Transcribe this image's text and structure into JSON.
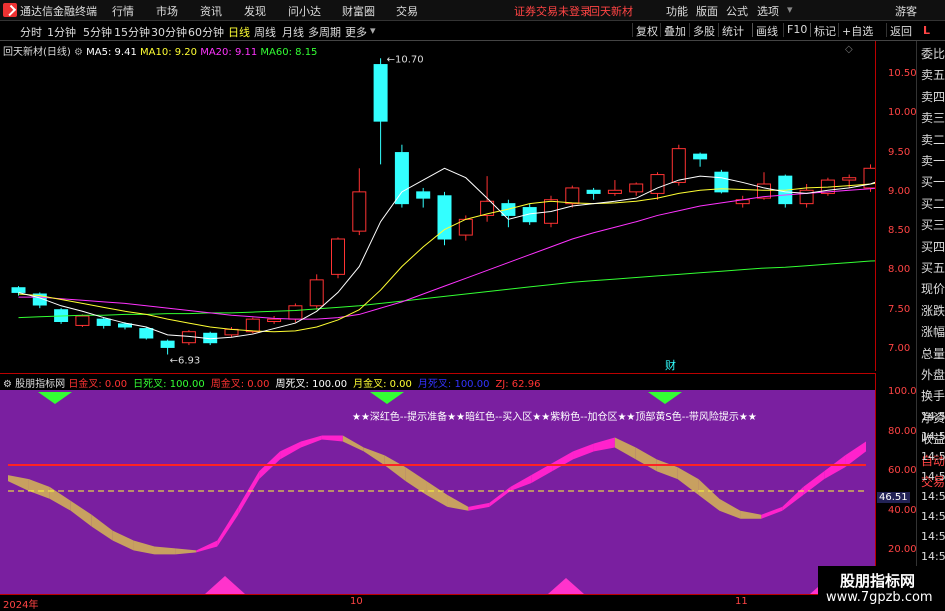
{
  "app": {
    "title": "通达信金融终端",
    "menu": [
      "行情",
      "市场",
      "资讯",
      "发现",
      "问小达",
      "财富圈",
      "交易"
    ],
    "notice": "证券交易未登录",
    "stock_name": "回天新材",
    "right_menu": [
      "功能",
      "版面",
      "公式",
      "选项"
    ],
    "guest": "游客"
  },
  "periods": {
    "items": [
      "分时",
      "1分钟",
      "5分钟",
      "15分钟",
      "30分钟",
      "60分钟",
      "日线",
      "周线",
      "月线",
      "多周期",
      "更多"
    ],
    "active": "日线",
    "tools": [
      "复权",
      "叠加",
      "多股",
      "统计",
      "画线",
      "F10",
      "标记",
      "+自选",
      "返回"
    ]
  },
  "info": {
    "title": "回天新材(日线)",
    "ma5": "MA5: 9.41",
    "ma10": "MA10: 9.20",
    "ma20": "MA20: 9.11",
    "ma60": "MA60: 8.15",
    "high_label": "10.70",
    "low_label": "6.93",
    "event_mark": "财"
  },
  "price_axis": [
    "10.50",
    "10.00",
    "9.50",
    "9.00",
    "8.50",
    "8.00",
    "7.50",
    "7.00"
  ],
  "right_panel": [
    "委比",
    "卖五",
    "卖四",
    "卖三",
    "卖二",
    "卖一",
    "买一",
    "买二",
    "买三",
    "买四",
    "买五",
    "现价",
    "涨跌",
    "涨幅",
    "总量",
    "外盘",
    "换手",
    "净资",
    "收益",
    "自动",
    "交易"
  ],
  "right_panel_time": "14:5",
  "indicator": {
    "name": "股朋指标网",
    "items": [
      {
        "label": "日金叉: 0.00",
        "color": "#ff3333"
      },
      {
        "label": "日死叉: 100.00",
        "color": "#33ff33"
      },
      {
        "label": "周金叉: 0.00",
        "color": "#ff3333"
      },
      {
        "label": "周死叉: 100.00",
        "color": "#ffffff"
      },
      {
        "label": "月金叉: 0.00",
        "color": "#ffff33"
      },
      {
        "label": "月死叉: 100.00",
        "color": "#3333ff"
      },
      {
        "label": "ZJ: 62.96",
        "color": "#ff3333"
      }
    ],
    "note": "★★深红色--提示准备★★暗红色--买入区★★紫粉色--加仓区★★顶部黄S色--带风险提示★★",
    "axis": [
      "100.0",
      "80.00",
      "60.00",
      "40.00",
      "20.00"
    ],
    "current": "46.51"
  },
  "xaxis": [
    "2024年",
    "10",
    "11"
  ],
  "watermark": {
    "line1": "股朋指标网",
    "line2": "www.7gpzb.com"
  },
  "colors": {
    "up": "#ff3333",
    "down": "#33ffff",
    "ma5": "#ffffff",
    "ma10": "#ffff33",
    "ma20": "#ff33ff",
    "ma60": "#33ff33",
    "ind_bg": "#7a1fa0"
  },
  "candles": [
    [
      7.78,
      7.72,
      7.8,
      7.68
    ],
    [
      7.7,
      7.56,
      7.72,
      7.52
    ],
    [
      7.5,
      7.35,
      7.52,
      7.32
    ],
    [
      7.3,
      7.42,
      7.44,
      7.28
    ],
    [
      7.38,
      7.3,
      7.4,
      7.26
    ],
    [
      7.32,
      7.28,
      7.34,
      7.25
    ],
    [
      7.26,
      7.14,
      7.28,
      7.12
    ],
    [
      7.1,
      7.02,
      7.12,
      6.93
    ],
    [
      7.08,
      7.22,
      7.24,
      7.05
    ],
    [
      7.2,
      7.08,
      7.22,
      7.05
    ],
    [
      7.18,
      7.25,
      7.28,
      7.15
    ],
    [
      7.22,
      7.38,
      7.4,
      7.2
    ],
    [
      7.35,
      7.38,
      7.42,
      7.32
    ],
    [
      7.38,
      7.55,
      7.58,
      7.34
    ],
    [
      7.55,
      7.88,
      7.95,
      7.5
    ],
    [
      7.95,
      8.4,
      8.42,
      7.9
    ],
    [
      8.5,
      9.0,
      9.3,
      8.45
    ],
    [
      10.62,
      9.9,
      10.7,
      9.35
    ],
    [
      9.5,
      8.85,
      9.6,
      8.8
    ],
    [
      9.0,
      8.92,
      9.05,
      8.8
    ],
    [
      8.95,
      8.4,
      9.0,
      8.32
    ],
    [
      8.45,
      8.65,
      8.7,
      8.38
    ],
    [
      8.7,
      8.88,
      9.2,
      8.62
    ],
    [
      8.85,
      8.7,
      8.9,
      8.55
    ],
    [
      8.8,
      8.62,
      8.85,
      8.58
    ],
    [
      8.6,
      8.9,
      8.95,
      8.55
    ],
    [
      8.85,
      9.05,
      9.08,
      8.8
    ],
    [
      9.02,
      8.98,
      9.05,
      8.9
    ],
    [
      8.98,
      9.02,
      9.15,
      8.95
    ],
    [
      9.0,
      9.1,
      9.12,
      8.95
    ],
    [
      8.98,
      9.22,
      9.25,
      8.9
    ],
    [
      9.12,
      9.55,
      9.6,
      9.08
    ],
    [
      9.48,
      9.42,
      9.5,
      9.32
    ],
    [
      9.25,
      9.0,
      9.28,
      8.98
    ],
    [
      8.85,
      8.9,
      8.95,
      8.8
    ],
    [
      8.92,
      9.1,
      9.25,
      8.9
    ],
    [
      9.2,
      8.85,
      9.22,
      8.8
    ],
    [
      8.85,
      9.02,
      9.1,
      8.8
    ],
    [
      8.98,
      9.15,
      9.18,
      8.95
    ],
    [
      9.15,
      9.18,
      9.22,
      9.05
    ],
    [
      9.05,
      9.3,
      9.35,
      9.0
    ],
    [
      9.45,
      9.4,
      9.48,
      9.3
    ],
    [
      9.42,
      9.95,
      9.98,
      9.4
    ]
  ],
  "ma5": [
    7.72,
    7.65,
    7.55,
    7.48,
    7.4,
    7.33,
    7.28,
    7.18,
    7.16,
    7.13,
    7.15,
    7.19,
    7.26,
    7.33,
    7.48,
    7.72,
    8.05,
    8.62,
    9.0,
    9.15,
    9.3,
    9.18,
    8.92,
    8.65,
    8.72,
    8.75,
    8.82,
    8.85,
    8.88,
    8.92,
    9.05,
    9.15,
    9.2,
    9.18,
    9.12,
    9.05,
    9.0,
    8.98,
    9.02,
    9.05,
    9.1,
    9.2,
    9.41
  ],
  "ma10": [
    7.7,
    7.68,
    7.63,
    7.58,
    7.53,
    7.48,
    7.44,
    7.38,
    7.33,
    7.28,
    7.25,
    7.23,
    7.22,
    7.23,
    7.28,
    7.37,
    7.5,
    7.75,
    8.05,
    8.3,
    8.52,
    8.65,
    8.72,
    8.78,
    8.85,
    8.88,
    8.86,
    8.85,
    8.86,
    8.88,
    8.92,
    8.98,
    9.02,
    9.04,
    9.03,
    9.02,
    9.02,
    9.05,
    9.06,
    9.08,
    9.1,
    9.14,
    9.2
  ],
  "ma20": [
    7.66,
    7.66,
    7.64,
    7.62,
    7.6,
    7.58,
    7.55,
    7.52,
    7.49,
    7.46,
    7.43,
    7.41,
    7.39,
    7.38,
    7.38,
    7.4,
    7.44,
    7.52,
    7.6,
    7.7,
    7.8,
    7.9,
    8.0,
    8.1,
    8.2,
    8.3,
    8.4,
    8.48,
    8.55,
    8.62,
    8.7,
    8.76,
    8.82,
    8.86,
    8.9,
    8.94,
    8.96,
    8.98,
    9.0,
    9.02,
    9.04,
    9.07,
    9.11
  ],
  "ma60": [
    7.4,
    7.41,
    7.42,
    7.43,
    7.43,
    7.44,
    7.44,
    7.45,
    7.45,
    7.46,
    7.46,
    7.47,
    7.48,
    7.49,
    7.51,
    7.53,
    7.55,
    7.58,
    7.61,
    7.64,
    7.67,
    7.7,
    7.73,
    7.76,
    7.79,
    7.82,
    7.85,
    7.87,
    7.89,
    7.91,
    7.93,
    7.95,
    7.97,
    7.99,
    8.01,
    8.03,
    8.04,
    8.06,
    8.08,
    8.1,
    8.12,
    8.13,
    8.15
  ],
  "ind_upper": [
    58,
    56,
    52,
    45,
    38,
    30,
    25,
    22,
    21,
    20,
    25,
    42,
    60,
    70,
    75,
    78,
    78,
    72,
    68,
    62,
    55,
    48,
    42,
    44,
    52,
    58,
    64,
    70,
    74,
    77,
    72,
    66,
    62,
    56,
    46,
    40,
    38,
    42,
    52,
    60,
    68,
    75
  ],
  "ind_lower": [
    55,
    50,
    46,
    40,
    32,
    25,
    20,
    18,
    18,
    19,
    22,
    38,
    56,
    66,
    72,
    76,
    75,
    70,
    63,
    55,
    48,
    42,
    40,
    42,
    50,
    54,
    60,
    66,
    70,
    72,
    66,
    60,
    56,
    48,
    40,
    36,
    36,
    40,
    48,
    56,
    62,
    70
  ]
}
